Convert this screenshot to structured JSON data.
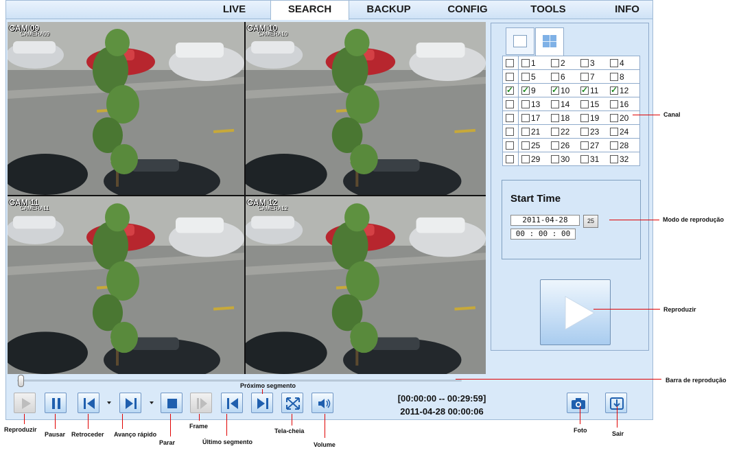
{
  "tabs": [
    {
      "label": "LIVE",
      "active": false
    },
    {
      "label": "SEARCH",
      "active": true
    },
    {
      "label": "BACKUP",
      "active": false
    },
    {
      "label": "CONFIG",
      "active": false
    },
    {
      "label": "TOOLS",
      "active": false
    },
    {
      "label": "INFO",
      "active": false
    }
  ],
  "cameras": [
    {
      "label": "CAM 09",
      "name": "CAMERA09"
    },
    {
      "label": "CAM 10",
      "name": "CAMERA10"
    },
    {
      "label": "CAM 11",
      "name": "CAMERA11"
    },
    {
      "label": "CAM 12",
      "name": "CAMERA12"
    }
  ],
  "channels": {
    "rows": [
      {
        "checked": false,
        "items": [
          {
            "n": "1",
            "checked": false
          },
          {
            "n": "2",
            "checked": false
          },
          {
            "n": "3",
            "checked": false
          },
          {
            "n": "4",
            "checked": false
          }
        ]
      },
      {
        "checked": false,
        "items": [
          {
            "n": "5",
            "checked": false
          },
          {
            "n": "6",
            "checked": false
          },
          {
            "n": "7",
            "checked": false
          },
          {
            "n": "8",
            "checked": false
          }
        ]
      },
      {
        "checked": true,
        "items": [
          {
            "n": "9",
            "checked": true
          },
          {
            "n": "10",
            "checked": true
          },
          {
            "n": "11",
            "checked": true
          },
          {
            "n": "12",
            "checked": true
          }
        ]
      },
      {
        "checked": false,
        "items": [
          {
            "n": "13",
            "checked": false
          },
          {
            "n": "14",
            "checked": false
          },
          {
            "n": "15",
            "checked": false
          },
          {
            "n": "16",
            "checked": false
          }
        ]
      },
      {
        "checked": false,
        "items": [
          {
            "n": "17",
            "checked": false
          },
          {
            "n": "18",
            "checked": false
          },
          {
            "n": "19",
            "checked": false
          },
          {
            "n": "20",
            "checked": false
          }
        ]
      },
      {
        "checked": false,
        "items": [
          {
            "n": "21",
            "checked": false
          },
          {
            "n": "22",
            "checked": false
          },
          {
            "n": "23",
            "checked": false
          },
          {
            "n": "24",
            "checked": false
          }
        ]
      },
      {
        "checked": false,
        "items": [
          {
            "n": "25",
            "checked": false
          },
          {
            "n": "26",
            "checked": false
          },
          {
            "n": "27",
            "checked": false
          },
          {
            "n": "28",
            "checked": false
          }
        ]
      },
      {
        "checked": false,
        "items": [
          {
            "n": "29",
            "checked": false
          },
          {
            "n": "30",
            "checked": false
          },
          {
            "n": "31",
            "checked": false
          },
          {
            "n": "32",
            "checked": false
          }
        ]
      }
    ]
  },
  "start_time": {
    "title": "Start Time",
    "date": "2011-04-28",
    "time": "00 : 00 : 00",
    "calendar_day": "25"
  },
  "playback": {
    "progress_fraction": 0.0,
    "range": "[00:00:00 -- 00:29:59]",
    "current": "2011-04-28 00:00:06"
  },
  "controls": [
    {
      "id": "play",
      "icon": "play-icon",
      "enabled": false
    },
    {
      "id": "pause",
      "icon": "pause-icon",
      "enabled": true
    },
    {
      "id": "rewind",
      "icon": "rewind-icon",
      "enabled": true
    },
    {
      "id": "fast-forward",
      "icon": "fast-forward-icon",
      "enabled": true
    },
    {
      "id": "stop",
      "icon": "stop-icon",
      "enabled": true
    },
    {
      "id": "frame",
      "icon": "frame-step-icon",
      "enabled": false
    },
    {
      "id": "prev-segment",
      "icon": "skip-back-icon",
      "enabled": true
    },
    {
      "id": "next-segment",
      "icon": "skip-forward-icon",
      "enabled": true
    },
    {
      "id": "fullscreen",
      "icon": "fullscreen-icon",
      "enabled": true
    },
    {
      "id": "volume",
      "icon": "volume-icon",
      "enabled": true
    },
    {
      "id": "snapshot",
      "icon": "camera-icon",
      "enabled": true
    },
    {
      "id": "exit",
      "icon": "exit-icon",
      "enabled": true
    }
  ],
  "annotations": {
    "canal": "Canal",
    "modo": "Modo de reprodução",
    "reproduzir_big": "Reproduzir",
    "barra": "Barra de reprodução",
    "reproduzir": "Reproduzir",
    "pausar": "Pausar",
    "retroceder": "Retroceder",
    "avanco": "Avanço rápido",
    "parar": "Parar",
    "frame": "Frame",
    "ultimo": "Último segmento",
    "proximo": "Próximo segmento",
    "tela": "Tela-cheia",
    "volume": "Volume",
    "foto": "Foto",
    "sair": "Sair"
  },
  "colors": {
    "annotation_line": "#e00000",
    "panel_bg": "#d9e9f9",
    "button_border": "#6f95c4",
    "button_icon": "#1f5fae"
  }
}
